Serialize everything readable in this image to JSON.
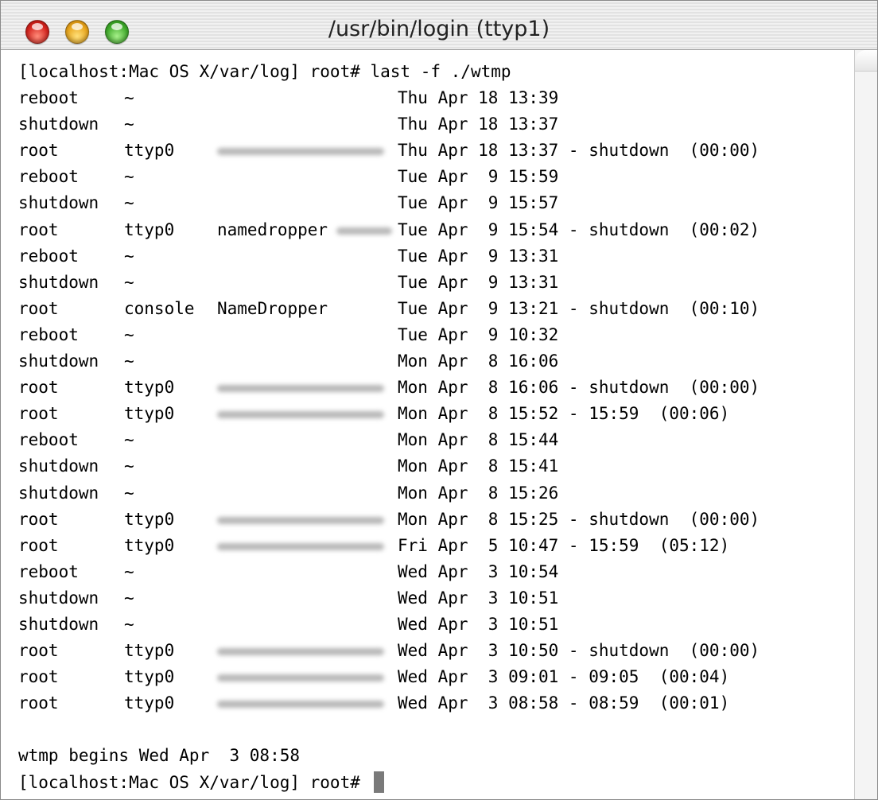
{
  "window": {
    "title": "/usr/bin/login  (ttyp1)"
  },
  "terminal": {
    "command_line": "[localhost:Mac OS X/var/log] root# last -f ./wtmp",
    "rows": [
      {
        "user": "reboot",
        "tty": "~",
        "host": "",
        "host_redacted": false,
        "date": "Thu Apr 18 13:39"
      },
      {
        "user": "shutdown",
        "tty": "~",
        "host": "",
        "host_redacted": false,
        "date": "Thu Apr 18 13:37"
      },
      {
        "user": "root",
        "tty": "ttyp0",
        "host": "",
        "host_redacted": true,
        "date": "Thu Apr 18 13:37 - shutdown  (00:00)"
      },
      {
        "user": "reboot",
        "tty": "~",
        "host": "",
        "host_redacted": false,
        "date": "Tue Apr  9 15:59"
      },
      {
        "user": "shutdown",
        "tty": "~",
        "host": "",
        "host_redacted": false,
        "date": "Tue Apr  9 15:57"
      },
      {
        "user": "root",
        "tty": "ttyp0",
        "host": "namedropper",
        "host_redacted": true,
        "date": "Tue Apr  9 15:54 - shutdown  (00:02)"
      },
      {
        "user": "reboot",
        "tty": "~",
        "host": "",
        "host_redacted": false,
        "date": "Tue Apr  9 13:31"
      },
      {
        "user": "shutdown",
        "tty": "~",
        "host": "",
        "host_redacted": false,
        "date": "Tue Apr  9 13:31"
      },
      {
        "user": "root",
        "tty": "console",
        "host": "NameDropper",
        "host_redacted": false,
        "date": "Tue Apr  9 13:21 - shutdown  (00:10)"
      },
      {
        "user": "reboot",
        "tty": "~",
        "host": "",
        "host_redacted": false,
        "date": "Tue Apr  9 10:32"
      },
      {
        "user": "shutdown",
        "tty": "~",
        "host": "",
        "host_redacted": false,
        "date": "Mon Apr  8 16:06"
      },
      {
        "user": "root",
        "tty": "ttyp0",
        "host": "",
        "host_redacted": true,
        "date": "Mon Apr  8 16:06 - shutdown  (00:00)"
      },
      {
        "user": "root",
        "tty": "ttyp0",
        "host": "",
        "host_redacted": true,
        "date": "Mon Apr  8 15:52 - 15:59  (00:06)"
      },
      {
        "user": "reboot",
        "tty": "~",
        "host": "",
        "host_redacted": false,
        "date": "Mon Apr  8 15:44"
      },
      {
        "user": "shutdown",
        "tty": "~",
        "host": "",
        "host_redacted": false,
        "date": "Mon Apr  8 15:41"
      },
      {
        "user": "shutdown",
        "tty": "~",
        "host": "",
        "host_redacted": false,
        "date": "Mon Apr  8 15:26"
      },
      {
        "user": "root",
        "tty": "ttyp0",
        "host": "",
        "host_redacted": true,
        "date": "Mon Apr  8 15:25 - shutdown  (00:00)"
      },
      {
        "user": "root",
        "tty": "ttyp0",
        "host": "",
        "host_redacted": true,
        "date": "Fri Apr  5 10:47 - 15:59  (05:12)"
      },
      {
        "user": "reboot",
        "tty": "~",
        "host": "",
        "host_redacted": false,
        "date": "Wed Apr  3 10:54"
      },
      {
        "user": "shutdown",
        "tty": "~",
        "host": "",
        "host_redacted": false,
        "date": "Wed Apr  3 10:51"
      },
      {
        "user": "shutdown",
        "tty": "~",
        "host": "",
        "host_redacted": false,
        "date": "Wed Apr  3 10:51"
      },
      {
        "user": "root",
        "tty": "ttyp0",
        "host": "",
        "host_redacted": true,
        "date": "Wed Apr  3 10:50 - shutdown  (00:00)"
      },
      {
        "user": "root",
        "tty": "ttyp0",
        "host": "",
        "host_redacted": true,
        "date": "Wed Apr  3 09:01 - 09:05  (00:04)"
      },
      {
        "user": "root",
        "tty": "ttyp0",
        "host": "",
        "host_redacted": true,
        "date": "Wed Apr  3 08:58 - 08:59  (00:01)"
      }
    ],
    "footer_line": "wtmp begins Wed Apr  3 08:58",
    "prompt": "[localhost:Mac OS X/var/log] root# "
  },
  "icons": {
    "close": "close-traffic-light-icon",
    "minimize": "minimize-traffic-light-icon",
    "zoom": "zoom-traffic-light-icon"
  },
  "colors": {
    "close": "#d4221c",
    "minimize": "#e8a41a",
    "zoom": "#3faa2a"
  }
}
